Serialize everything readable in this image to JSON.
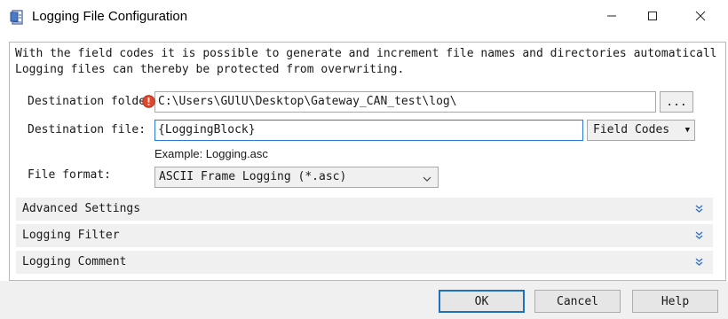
{
  "window": {
    "title": "Logging File Configuration",
    "icon": "document-settings-icon",
    "controls": [
      "minimize-icon",
      "maximize-icon",
      "close-icon"
    ]
  },
  "description": {
    "line1": "With the field codes it is possible to generate and increment file names and directories automaticall",
    "line2": "Logging files can thereby be protected from overwriting."
  },
  "destination_folder": {
    "label": "Destination folder:",
    "value": "C:\\Users\\GUlU\\Desktop\\Gateway_CAN_test\\log\\",
    "browse_label": "..."
  },
  "destination_file": {
    "label": "Destination file:",
    "value": "{LoggingBlock}",
    "field_codes_label": "Field Codes"
  },
  "example": {
    "text": "Example: Logging.asc"
  },
  "file_format": {
    "label": "File format:",
    "selected": "ASCII Frame Logging (*.asc)"
  },
  "sections": {
    "advanced": "Advanced Settings",
    "filter": "Logging Filter",
    "comment": "Logging Comment"
  },
  "buttons": {
    "ok": "OK",
    "cancel": "Cancel",
    "help": "Help"
  },
  "colors": {
    "accent": "#1f6fc5",
    "warning": "#e0462b",
    "section_bg": "#f0f0f0"
  }
}
